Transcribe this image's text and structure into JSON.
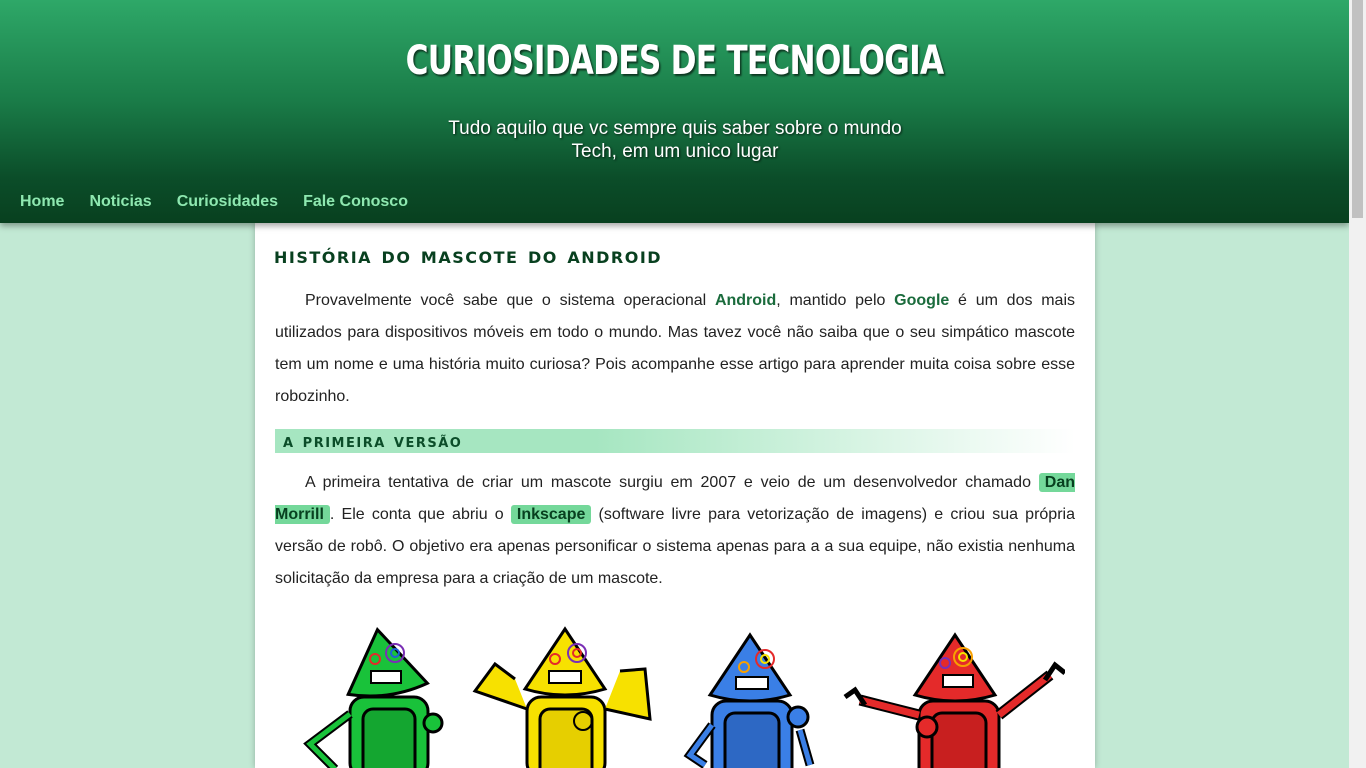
{
  "header": {
    "title": "CURIOSIDADES DE TECNOLOGIA",
    "subtitle": "Tudo aquilo que vc sempre quis saber sobre o mundo Tech, em um unico lugar"
  },
  "nav": {
    "items": [
      "Home",
      "Noticias",
      "Curiosidades",
      "Fale Conosco"
    ]
  },
  "article": {
    "title": "HISTÓRIA DO MASCOTE DO ANDROID",
    "p1": {
      "t1": "Provavelmente você sabe que o sistema operacional ",
      "android": "Android",
      "t2": ", mantido pelo ",
      "google": "Google",
      "t3": " é um dos mais utilizados para dispositivos móveis em todo o mundo. Mas tavez você não saiba que o seu simpático mascote tem um nome e uma história muito curiosa? Pois acompanhe esse artigo para aprender muita coisa sobre esse robozinho."
    },
    "section_title": "A PRIMEIRA VERSÃO",
    "p2": {
      "t1": "A primeira tentativa de criar um mascote surgiu em 2007 e veio de um desenvolvedor chamado ",
      "dan": "Dan Morrill",
      "t2": ". Ele conta que abriu o ",
      "inkscape": "Inkscape",
      "t3": " (software livre para vetorização de imagens) e criou sua própria versão de robô. O objetivo era apenas personificar o sistema apenas para a a sua equipe, não existia nenhuma solicitação da empresa para a criação de um mascote."
    }
  },
  "robots": [
    {
      "name": "green-robot",
      "color": "#19c23a"
    },
    {
      "name": "yellow-robot",
      "color": "#f7e100"
    },
    {
      "name": "blue-robot",
      "color": "#3a7fe6"
    },
    {
      "name": "red-robot",
      "color": "#e42a2a"
    }
  ],
  "colors": {
    "header_top": "#2ea868",
    "header_bottom": "#08401f",
    "nav_link": "#8ee8b0",
    "page_bg": "#c2e9d4",
    "accent": "#74d89a"
  }
}
